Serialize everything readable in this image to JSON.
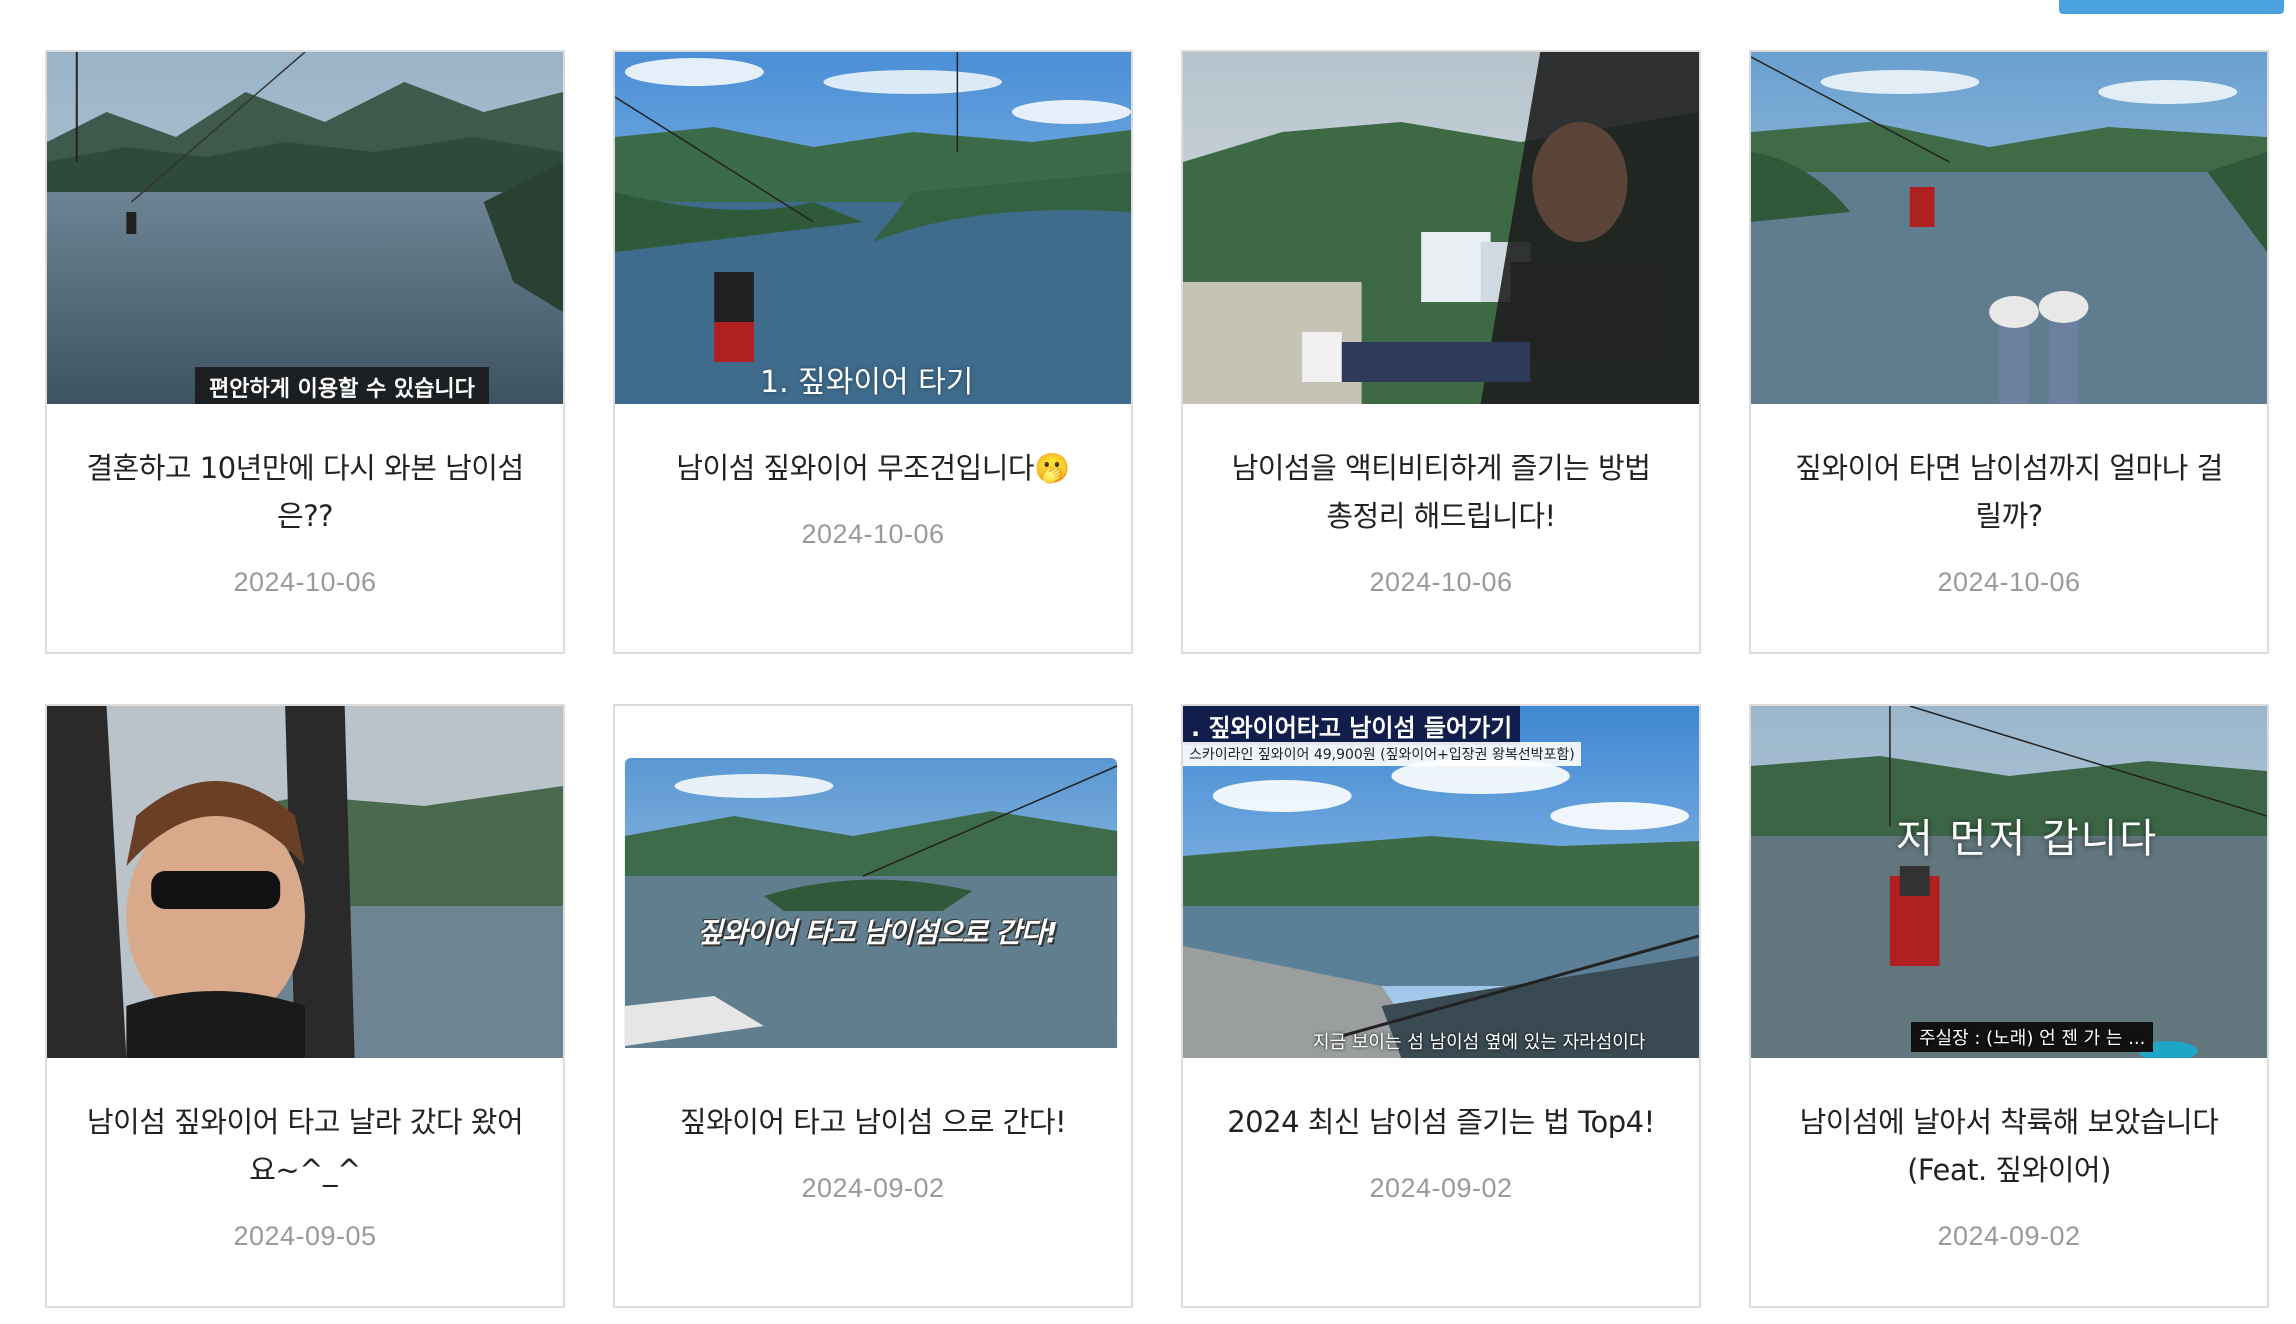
{
  "cards": [
    {
      "title": "결혼하고 10년만에 다시 와본 남이섬은??",
      "date": "2024-10-06",
      "thumb_caption": "편안하게 이용할 수 있습니다"
    },
    {
      "title": "남이섬 짚와이어 무조건입니다🫢",
      "date": "2024-10-06",
      "thumb_caption": "1. 짚와이어 타기"
    },
    {
      "title": "남이섬을 액티비티하게 즐기는 방법 총정리 해드립니다!",
      "date": "2024-10-06",
      "thumb_caption": ""
    },
    {
      "title": "짚와이어 타면 남이섬까지 얼마나 걸릴까?",
      "date": "2024-10-06",
      "thumb_caption": ""
    },
    {
      "title": "남이섬 짚와이어 타고 날라 갔다 왔어요~^_^",
      "date": "2024-09-05",
      "thumb_caption": ""
    },
    {
      "title": "짚와이어 타고 남이섬 으로 간다!",
      "date": "2024-09-02",
      "thumb_caption": "짚와이어 타고 남이섬으로 간다!"
    },
    {
      "title": "2024 최신 남이섬 즐기는 법 Top4!",
      "date": "2024-09-02",
      "thumb_caption": ". 짚와이어타고 남이섬 들어가기",
      "thumb_subcaption": "스카이라인 짚와이어 49,900원 (짚와이어+입장권 왕복선박포함)",
      "thumb_bottom_caption": "지금 보이는 섬 남이섬 옆에 있는 자라섬이다"
    },
    {
      "title": "남이섬에 날아서 착륙해 보았습니다 (Feat. 짚와이어)",
      "date": "2024-09-02",
      "thumb_caption": "저 먼저 갑니다",
      "thumb_bottom_caption": "주실장 : (노래) 언 젠 가 는 ..."
    }
  ]
}
